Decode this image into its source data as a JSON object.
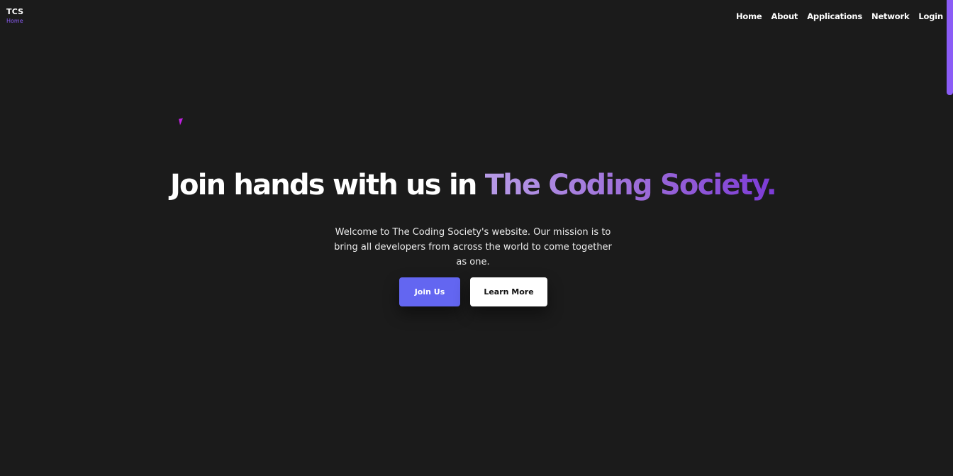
{
  "brand": {
    "name": "TCS",
    "subtitle": "Home"
  },
  "nav": {
    "items": [
      {
        "label": "Home"
      },
      {
        "label": "About"
      },
      {
        "label": "Applications"
      },
      {
        "label": "Network"
      },
      {
        "label": "Login"
      }
    ]
  },
  "hero": {
    "title_prefix": "Join hands with us in ",
    "title_accent": "The Coding Society.",
    "description": "Welcome to The Coding Society's website. Our mission is to bring all developers from across the world to come together as one.",
    "primary_button": "Join Us",
    "secondary_button": "Learn More"
  },
  "colors": {
    "background": "#1b1b1b",
    "accent": "#8b5cf6",
    "primary_button": "#6366f1",
    "accent_gradient_start": "#b79be6",
    "accent_gradient_end": "#7c3ad6"
  }
}
